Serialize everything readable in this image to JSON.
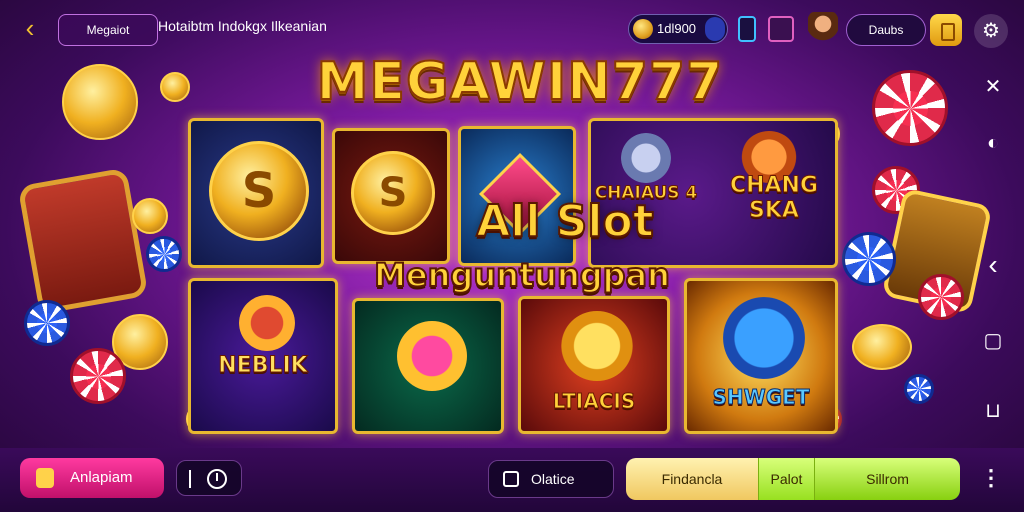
{
  "header": {
    "back_icon": "chevron-left-icon",
    "tag_label": "Megaiot",
    "menu_text": "Hotaibtm Indokgx Ilkeanian",
    "coin_balance": "1dl900",
    "user_label": "Daubs",
    "settings_icon": "gear-icon"
  },
  "hero": {
    "brand_title": "MEGAWIN777",
    "overlay_line_1": "All Slot",
    "overlay_line_2": "Menguntungpan"
  },
  "games": [
    {
      "name": ""
    },
    {
      "name": ""
    },
    {
      "name": ""
    },
    {
      "name_a": "CHAIAUS 4",
      "name_b": "CHANG SKA"
    },
    {
      "name": "NEBLIK"
    },
    {
      "name": ""
    },
    {
      "name": "LTIACIS"
    },
    {
      "name": "SHWGET"
    }
  ],
  "coin_glyph": "S",
  "side_panel": {
    "icons": [
      "close-icon",
      "chevron-left-icon",
      "square-icon",
      "box-icon"
    ]
  },
  "footer": {
    "primary_button": "Anlapiam",
    "online_label": "Olatice",
    "tabs": [
      "Findancla",
      "Palot",
      "Sillrom"
    ],
    "more_icon": "more-vertical-icon"
  },
  "colors": {
    "accent_gold": "#ffd23a",
    "primary_pink": "#ff3aa0",
    "tab_green": "#98e020",
    "bg_purple": "#7a1a9e"
  }
}
